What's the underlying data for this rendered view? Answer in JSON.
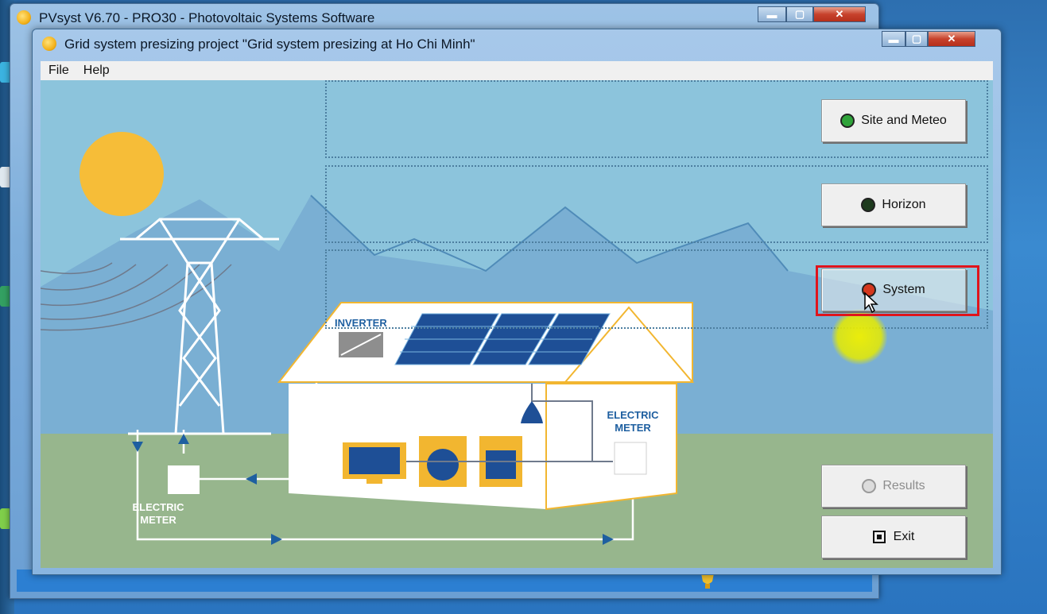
{
  "outer_window": {
    "title": "PVsyst V6.70 - PRO30 - Photovoltaic Systems Software",
    "minimize": "▬",
    "maximize": "▢",
    "close": "✕"
  },
  "inner_window": {
    "title": "Grid system presizing project  \"Grid system presizing  at  Ho Chi Minh\"",
    "minimize": "▬",
    "maximize": "▢",
    "close": "✕"
  },
  "menu": {
    "file": "File",
    "help": "Help"
  },
  "illustration": {
    "inverter_label": "INVERTER",
    "electric_meter_right_line1": "ELECTRIC",
    "electric_meter_right_line2": "METER",
    "electric_meter_left_line1": "ELECTRIC",
    "electric_meter_left_line2": "METER"
  },
  "buttons": {
    "site_meteo": {
      "label": "Site and Meteo",
      "led_color": "#2fa33a"
    },
    "horizon": {
      "label": "Horizon",
      "led_color": "#1e3b1e"
    },
    "system": {
      "label": "System",
      "led_color": "#d5371d"
    },
    "results": {
      "label": "Results",
      "state": "disabled"
    },
    "exit": {
      "label": "Exit"
    }
  },
  "colors": {
    "sky": "#8cc4dc",
    "ground": "#97b68d",
    "sun": "#f6bd38",
    "house_accent": "#f2b630",
    "panel_blue": "#1e4f96",
    "highlight": "#e0141c"
  }
}
